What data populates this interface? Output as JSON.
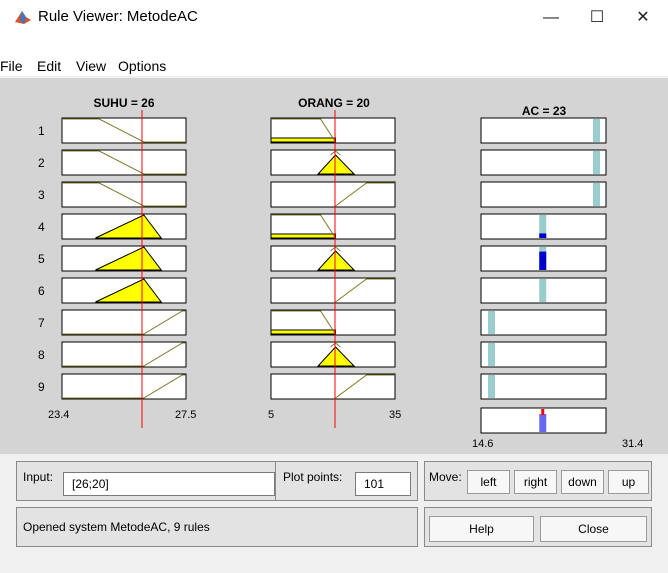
{
  "window": {
    "title": "Rule Viewer: MetodeAC",
    "minimize": "—",
    "maximize": "☐",
    "close": "✕"
  },
  "menu": [
    "File",
    "Edit",
    "View",
    "Options"
  ],
  "columns": {
    "suhu": {
      "header": "SUHU = 26",
      "min": "23.4",
      "max": "27.5"
    },
    "orang": {
      "header": "ORANG = 20",
      "min": "5",
      "max": "35"
    },
    "ac": {
      "header": "AC = 23",
      "min": "14.6",
      "max": "31.4"
    }
  },
  "rules": [
    "1",
    "2",
    "3",
    "4",
    "5",
    "6",
    "7",
    "8",
    "9"
  ],
  "bottom": {
    "input_label": "Input:",
    "input_value": "[26;20]",
    "plot_points_label": "Plot points:",
    "plot_points_value": "101",
    "move_label": "Move:",
    "move_buttons": [
      "left",
      "right",
      "down",
      "up"
    ],
    "status": "Opened system MetodeAC, 9 rules",
    "help": "Help",
    "close": "Close"
  },
  "colors": {
    "fill": "#ffff00",
    "line": "#7a7a2a",
    "marker": "#ff0000",
    "ac_bar": "#99cccc",
    "ac_active": "#0000cc"
  }
}
